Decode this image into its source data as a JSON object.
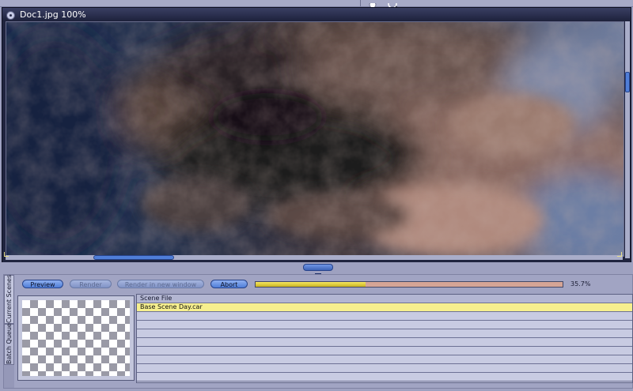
{
  "document": {
    "title": "Doc1.jpg 100%"
  },
  "render_panel": {
    "tabs": [
      {
        "label": "Current Scenes"
      },
      {
        "label": "Batch Queue"
      }
    ],
    "buttons": {
      "preview": "Preview",
      "render": "Render",
      "render_new_window": "Render in new window",
      "abort": "Abort"
    },
    "progress": {
      "value": 0.357,
      "label": "35.7%"
    },
    "scene_table": {
      "header": "Scene File",
      "rows": [
        "Base Scene Day.car",
        "",
        "",
        "",
        "",
        "",
        "",
        "",
        ""
      ],
      "selected_index": 0
    }
  },
  "colors": {
    "accent_button": "#4f7ed8",
    "progress_fill": "#f6e75f",
    "progress_track": "#d5a596",
    "selected_row": "#f6ef8e"
  }
}
